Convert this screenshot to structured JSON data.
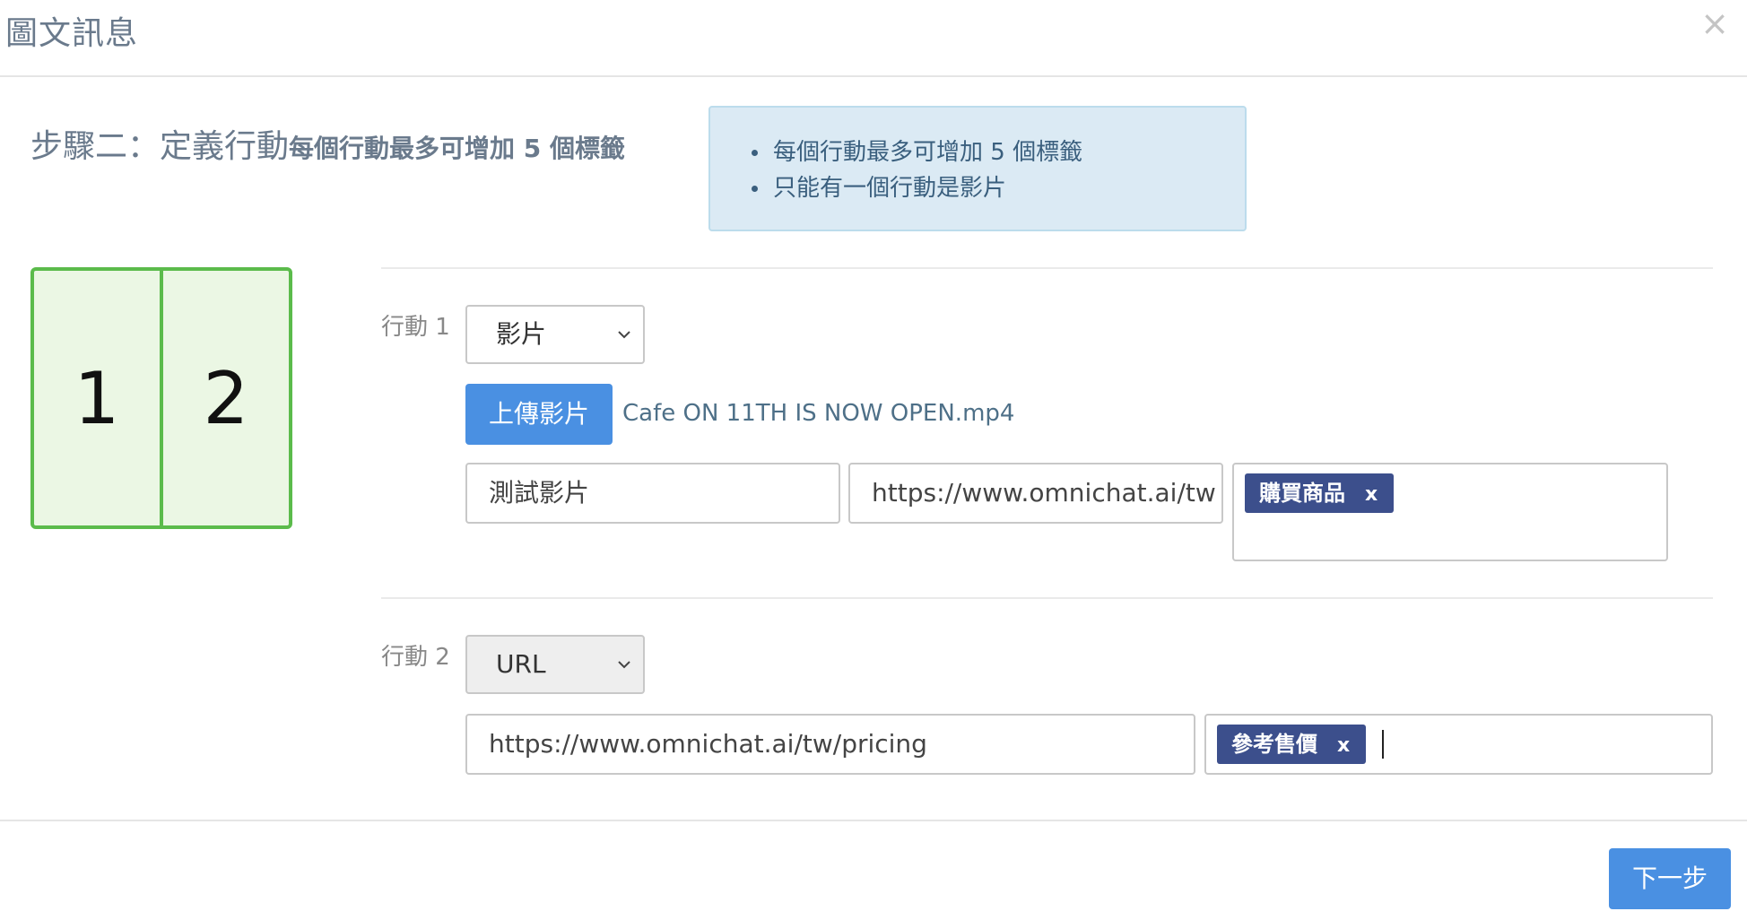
{
  "modal": {
    "title": "圖文訊息",
    "close_symbol": "×"
  },
  "step": {
    "title": "步驟二：定義行動",
    "hint": "每個行動最多可增加 5 個標籤"
  },
  "info": {
    "items": [
      "每個行動最多可增加 5 個標籤",
      "只能有一個行動是影片"
    ]
  },
  "layout_preview": {
    "cells": [
      "1",
      "2"
    ],
    "colors": {
      "border": "#5bbb4b",
      "fill": "#ebf7e4"
    }
  },
  "actions": [
    {
      "label": "行動 1",
      "type": "影片",
      "upload_label": "上傳影片",
      "file_name": "Cafe ON 11TH IS NOW OPEN.mp4",
      "title_value": "測試影片",
      "url_value": "https://www.omnichat.ai/tw",
      "tags": [
        "購買商品"
      ]
    },
    {
      "label": "行動 2",
      "type": "URL",
      "url_value": "https://www.omnichat.ai/tw/pricing",
      "tags": [
        "參考售價"
      ]
    }
  ],
  "tag_remove_label": "x",
  "footer": {
    "next_label": "下一步"
  },
  "colors": {
    "primary": "#4a90e2",
    "tag": "#3c4f8c",
    "info_bg": "#dbeaf4"
  }
}
